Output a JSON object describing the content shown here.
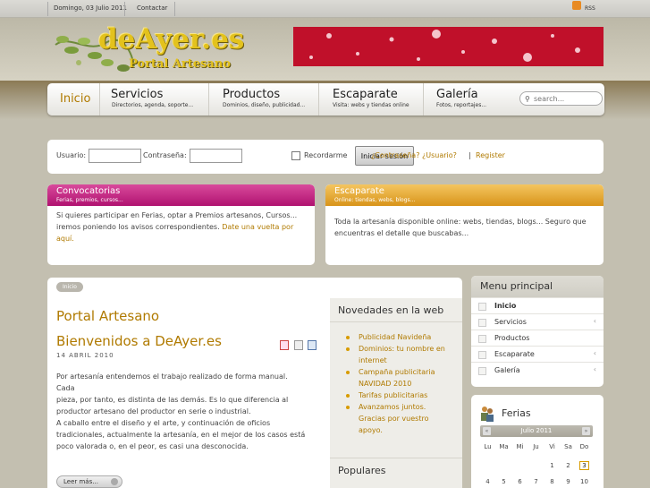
{
  "topbar": {
    "date": "Domingo, 03 Julio 2011",
    "contact": "Contactar",
    "rss": "RSS"
  },
  "header": {
    "logo": "deAyer.es",
    "logo_sub": "Portal Artesano"
  },
  "nav": [
    {
      "title": "Inicio",
      "sub": ""
    },
    {
      "title": "Servicios",
      "sub": "Directorios, agenda, soporte..."
    },
    {
      "title": "Productos",
      "sub": "Dominios, diseño, publicidad..."
    },
    {
      "title": "Escaparate",
      "sub": "Visita: webs y tiendas online"
    },
    {
      "title": "Galería",
      "sub": "Fotos, reportajes..."
    }
  ],
  "search": {
    "placeholder": "search..."
  },
  "login": {
    "user_label": "Usuario:",
    "pass_label": "Contraseña:",
    "remember": "Recordarme",
    "submit": "Iniciar sesión",
    "forgot": "¿Contraseña? ¿Usuario?",
    "divider": "|",
    "register": "Register"
  },
  "convocatorias": {
    "title": "Convocatorias",
    "sub": "Ferias, premios, cursos...",
    "text1": "Si quieres participar en Ferias, optar a Premios artesanos, Cursos...",
    "text2": "iremos poniendo los avisos correspondientes.",
    "link1": "Date una vuelta por",
    "link2": "aquí."
  },
  "escaparate": {
    "title": "Escaparate",
    "sub": "Online: tiendas, webs, blogs...",
    "text1": "Toda la artesanía disponible online: webs, tiendas, blogs... Seguro que",
    "text2": "encuentras el detalle que buscabas..."
  },
  "main": {
    "breadcrumb": "Inicio",
    "title": "Portal Artesano",
    "article_title": "Bienvenidos a DeAyer.es",
    "date": "14 ABRIL 2010",
    "p1": [
      "Por artesanía entendemos el trabajo realizado de forma manual. Cada",
      "pieza, por tanto, es distinta de las demás. Es lo que diferencia al",
      "productor artesano del productor en serie o industrial."
    ],
    "p2": [
      "A caballo entre el diseño y el arte, y continuación de oficios",
      "tradicionales, actualmente la artesanía, en el mejor de los casos está",
      "poco valorada o, en el peor, es casi una desconocida."
    ],
    "read_more": "Leer más..."
  },
  "novedades": {
    "title": "Novedades en la web",
    "items": [
      [
        "Publicidad Navideña"
      ],
      [
        "Dominios: tu nombre en",
        "internet"
      ],
      [
        "Campaña publicitaria",
        "NAVIDAD 2010"
      ],
      [
        "Tarifas publicitarias"
      ],
      [
        "Avanzamos juntos.",
        "Gracias por vuestro",
        "apoyo."
      ]
    ],
    "populares": "Populares"
  },
  "menu": {
    "title": "Menu principal",
    "items": [
      "Inicio",
      "Servicios",
      "Productos",
      "Escaparate",
      "Galería"
    ]
  },
  "ferias": {
    "title": "Ferias",
    "month": "Julio 2011",
    "prev": "«",
    "next": "»",
    "days": [
      "Lu",
      "Ma",
      "Mi",
      "Ju",
      "Vi",
      "Sa",
      "Do"
    ],
    "dates": [
      "1",
      "2",
      "3",
      "4",
      "5",
      "6",
      "7",
      "8",
      "9",
      "10"
    ],
    "today": "3"
  },
  "colors": {
    "accent": "#b07a00",
    "convocatorias": "#c2187a",
    "escaparate": "#e8a62a"
  }
}
